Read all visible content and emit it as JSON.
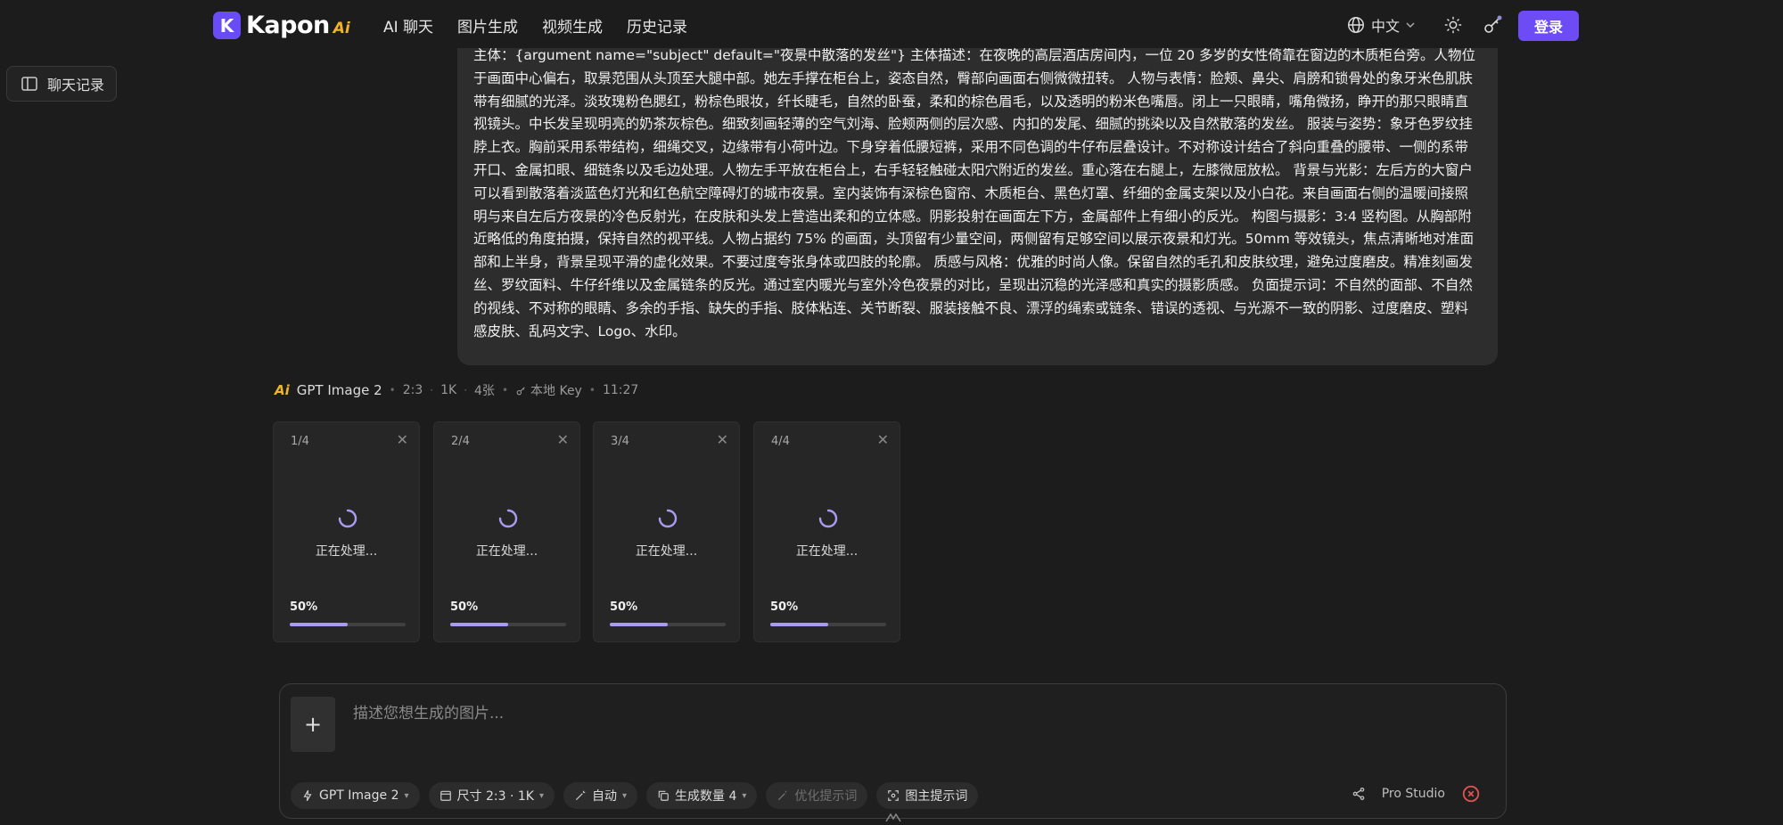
{
  "header": {
    "logo_text": "Kapon",
    "logo_ai": "Ai",
    "nav": [
      "AI 聊天",
      "图片生成",
      "视频生成",
      "历史记录"
    ],
    "language": "中文",
    "login_label": "登录"
  },
  "sidebar": {
    "history_label": "聊天记录"
  },
  "prompt": {
    "text": "主体：{argument name=\"subject\" default=\"夜景中散落的发丝\"} 主体描述：在夜晚的高层酒店房间内，一位 20 多岁的女性倚靠在窗边的木质柜台旁。人物位于画面中心偏右，取景范围从头顶至大腿中部。她左手撑在柜台上，姿态自然，臀部向画面右侧微微扭转。 人物与表情：脸颊、鼻尖、肩膀和锁骨处的象牙米色肌肤带有细腻的光泽。淡玫瑰粉色腮红，粉棕色眼妆，纤长睫毛，自然的卧蚕，柔和的棕色眉毛，以及透明的粉米色嘴唇。闭上一只眼睛，嘴角微扬，睁开的那只眼睛直视镜头。中长发呈现明亮的奶茶灰棕色。细致刻画轻薄的空气刘海、脸颊两侧的层次感、内扣的发尾、细腻的挑染以及自然散落的发丝。 服装与姿势：象牙色罗纹挂脖上衣。胸前采用系带结构，细绳交叉，边缘带有小荷叶边。下身穿着低腰短裤，采用不同色调的牛仔布层叠设计。不对称设计结合了斜向重叠的腰带、一侧的系带开口、金属扣眼、细链条以及毛边处理。人物左手平放在柜台上，右手轻轻触碰太阳穴附近的发丝。重心落在右腿上，左膝微屈放松。 背景与光影：左后方的大窗户可以看到散落着淡蓝色灯光和红色航空障碍灯的城市夜景。室内装饰有深棕色窗帘、木质柜台、黑色灯罩、纤细的金属支架以及小白花。来自画面右侧的温暖间接照明与来自左后方夜景的冷色反射光，在皮肤和头发上营造出柔和的立体感。阴影投射在画面左下方，金属部件上有细小的反光。 构图与摄影：3:4 竖构图。从胸部附近略低的角度拍摄，保持自然的视平线。人物占据约 75% 的画面，头顶留有少量空间，两侧留有足够空间以展示夜景和灯光。50mm 等效镜头，焦点清晰地对准面部和上半身，背景呈现平滑的虚化效果。不要过度夸张身体或四肢的轮廓。 质感与风格：优雅的时尚人像。保留自然的毛孔和皮肤纹理，避免过度磨皮。精准刻画发丝、罗纹面料、牛仔纤维以及金属链条的反光。通过室内暖光与室外冷色夜景的对比，呈现出沉稳的光泽感和真实的摄影质感。 负面提示词：不自然的面部、不自然的视线、不对称的眼睛、多余的手指、缺失的手指、肢体粘连、关节断裂、服装接触不良、漂浮的绳索或链条、错误的透视、与光源不一致的阴影、过度磨皮、塑料感皮肤、乱码文字、Logo、水印。"
  },
  "generation": {
    "ai_badge": "Ai",
    "model": "GPT Image 2",
    "ratio": "2:3",
    "resolution": "1K",
    "count": "4张",
    "key": "本地 Key",
    "time": "11:27",
    "cards": [
      {
        "index": "1/4",
        "status": "正在处理...",
        "percent_label": "50%",
        "progress": 0.5
      },
      {
        "index": "2/4",
        "status": "正在处理...",
        "percent_label": "50%",
        "progress": 0.5
      },
      {
        "index": "3/4",
        "status": "正在处理...",
        "percent_label": "50%",
        "progress": 0.5
      },
      {
        "index": "4/4",
        "status": "正在处理...",
        "percent_label": "50%",
        "progress": 0.5
      }
    ]
  },
  "composer": {
    "placeholder": "描述您想生成的图片...",
    "add_label": "+",
    "model_chip": "GPT Image 2",
    "size_chip": "尺寸 2:3 · 1K",
    "auto_chip": "自动",
    "count_chip": "生成数量 4",
    "optimize_chip": "优化提示词",
    "image_prompt_chip": "图主提示词",
    "pro_studio": "Pro Studio"
  },
  "colors": {
    "accent": "#6d4cf5",
    "progress": "#a99cf0",
    "ai_badge": "#f0b429",
    "stop": "#e05252"
  }
}
